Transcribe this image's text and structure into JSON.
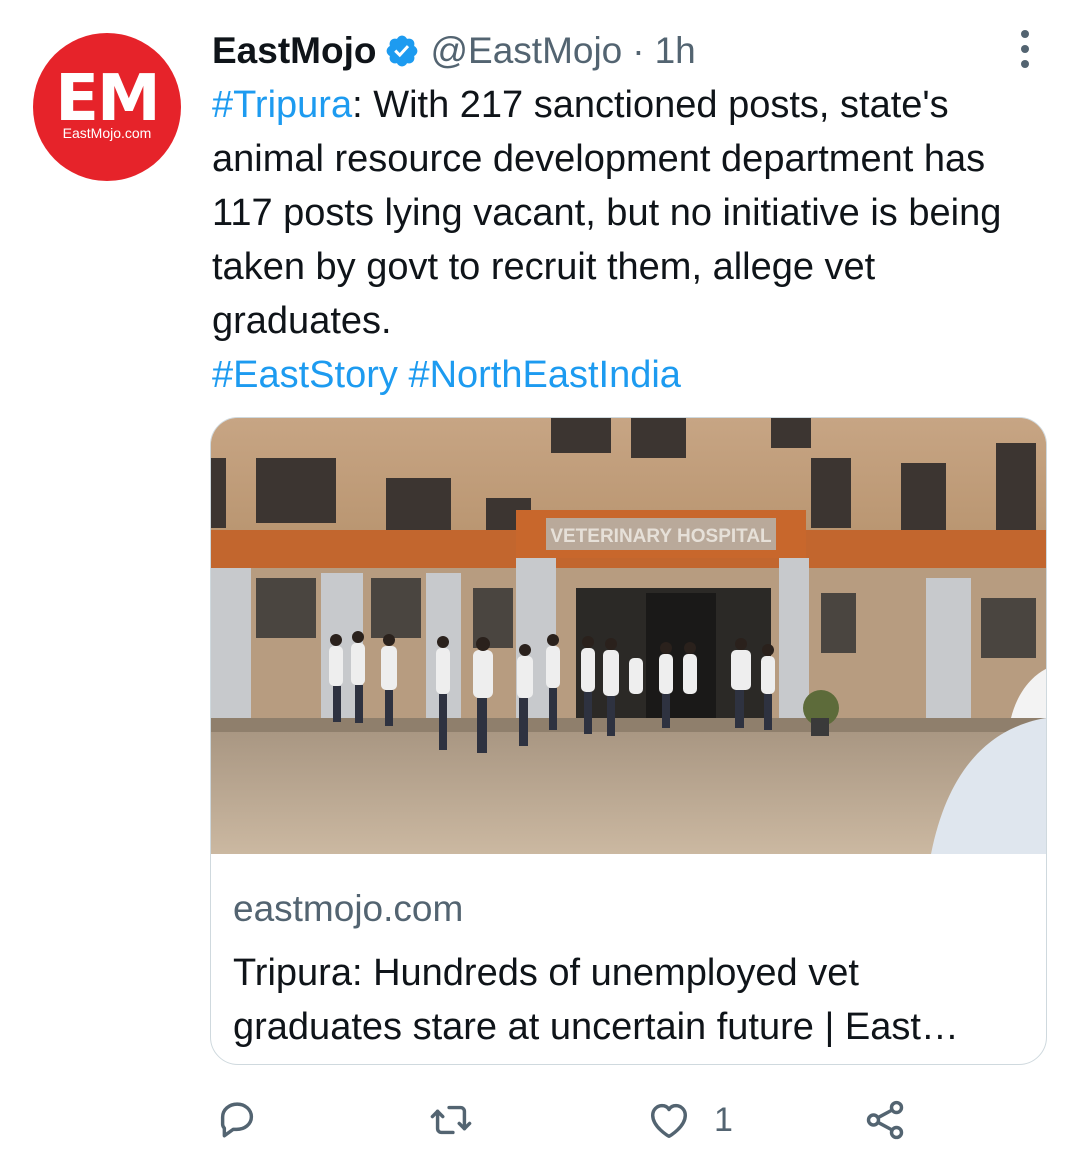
{
  "author": {
    "display_name": "EastMojo",
    "handle": "@EastMojo",
    "separator": "·",
    "time": "1h",
    "avatar_logo": "EM",
    "avatar_site": "EastMojo.com",
    "verified": true
  },
  "tweet": {
    "hashtag_lead": "#Tripura",
    "text": ": With 217 sanctioned posts, state's animal resource development department has 117 posts lying vacant, but no initiative is being taken by govt to recruit them, allege vet graduates.",
    "hashtag_1": "#EastStory",
    "hashtag_2": "#NorthEastIndia"
  },
  "card": {
    "image_sign": "VETERINARY HOSPITAL",
    "domain": "eastmojo.com",
    "title": "Tripura: Hundreds of unemployed vet graduates stare at uncertain future | East…"
  },
  "actions": {
    "reply_icon": "reply-icon",
    "retweet_icon": "retweet-icon",
    "like_icon": "heart-icon",
    "like_count": "1",
    "share_icon": "share-icon"
  },
  "colors": {
    "accent": "#1d9bf0",
    "avatar_bg": "#e6232a",
    "secondary_text": "#536471",
    "border": "#cfd9de"
  }
}
